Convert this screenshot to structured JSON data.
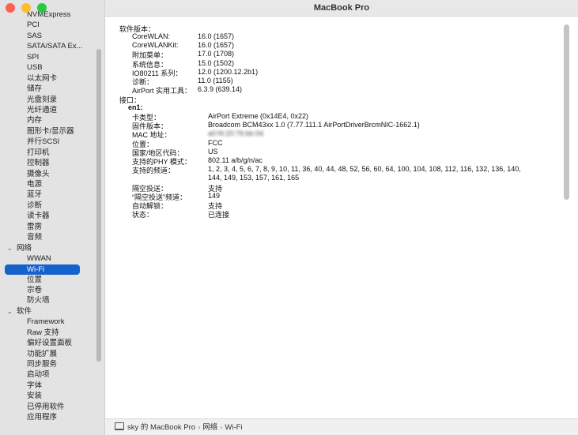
{
  "window": {
    "title": "MacBook Pro"
  },
  "colors": {
    "close": "#fe5f57",
    "minimize": "#febc2e",
    "maximize": "#28c840",
    "selection": "#1662cc"
  },
  "sidebar": {
    "items": [
      {
        "label": "NVMExpress",
        "kind": "item"
      },
      {
        "label": "PCI",
        "kind": "item"
      },
      {
        "label": "SAS",
        "kind": "item"
      },
      {
        "label": "SATA/SATA Ex...",
        "kind": "item"
      },
      {
        "label": "SPI",
        "kind": "item"
      },
      {
        "label": "USB",
        "kind": "item"
      },
      {
        "label": "以太网卡",
        "kind": "item"
      },
      {
        "label": "储存",
        "kind": "item"
      },
      {
        "label": "光盘刻录",
        "kind": "item"
      },
      {
        "label": "光纤通道",
        "kind": "item"
      },
      {
        "label": "内存",
        "kind": "item"
      },
      {
        "label": "图形卡/显示器",
        "kind": "item"
      },
      {
        "label": "并行SCSI",
        "kind": "item"
      },
      {
        "label": "打印机",
        "kind": "item"
      },
      {
        "label": "控制器",
        "kind": "item"
      },
      {
        "label": "摄像头",
        "kind": "item"
      },
      {
        "label": "电源",
        "kind": "item"
      },
      {
        "label": "蓝牙",
        "kind": "item"
      },
      {
        "label": "诊断",
        "kind": "item"
      },
      {
        "label": "读卡器",
        "kind": "item"
      },
      {
        "label": "雷雳",
        "kind": "item"
      },
      {
        "label": "音频",
        "kind": "item"
      },
      {
        "label": "网络",
        "kind": "group"
      },
      {
        "label": "WWAN",
        "kind": "item"
      },
      {
        "label": "Wi-Fi",
        "kind": "selected"
      },
      {
        "label": "位置",
        "kind": "item"
      },
      {
        "label": "宗卷",
        "kind": "item"
      },
      {
        "label": "防火墙",
        "kind": "item"
      },
      {
        "label": "软件",
        "kind": "group"
      },
      {
        "label": "Framework",
        "kind": "item"
      },
      {
        "label": "Raw 支持",
        "kind": "item"
      },
      {
        "label": "偏好设置面板",
        "kind": "item"
      },
      {
        "label": "功能扩展",
        "kind": "item"
      },
      {
        "label": "同步服务",
        "kind": "item"
      },
      {
        "label": "启动项",
        "kind": "item"
      },
      {
        "label": "字体",
        "kind": "item"
      },
      {
        "label": "安装",
        "kind": "item"
      },
      {
        "label": "已停用软件",
        "kind": "item"
      },
      {
        "label": "应用程序",
        "kind": "item"
      }
    ]
  },
  "content": {
    "software_header": "软件版本：",
    "software_rows": [
      {
        "key": "CoreWLAN:",
        "value": "16.0 (1657)"
      },
      {
        "key": "CoreWLANKit:",
        "value": "16.0 (1657)"
      },
      {
        "key": "附加菜单：",
        "value": "17.0 (1708)"
      },
      {
        "key": "系统信息：",
        "value": "15.0 (1502)"
      },
      {
        "key": "IO80211 系列：",
        "value": "12.0 (1200.12.2b1)"
      },
      {
        "key": "诊断：",
        "value": "11.0 (1155)"
      },
      {
        "key": "AirPort 实用工具：",
        "value": "6.3.9 (639.14)"
      }
    ],
    "interfaces_header": "接口：",
    "interface_name": "en1:",
    "interface_rows": [
      {
        "key": "卡类型：",
        "value": "AirPort Extreme  (0x14E4, 0x22)"
      },
      {
        "key": "固件版本：",
        "value": "Broadcom BCM43xx 1.0 (7.77.111.1 AirPortDriverBrcmNIC-1662.1)"
      },
      {
        "key": "MAC 地址：",
        "value": "a0:f4:20:76:bb:0d"
      },
      {
        "key": "位置：",
        "value": "FCC"
      },
      {
        "key": "国家/地区代码：",
        "value": "US"
      },
      {
        "key": "支持的PHY 模式：",
        "value": "802.11 a/b/g/n/ac"
      },
      {
        "key": "支持的频道：",
        "value": "1, 2, 3, 4, 5, 6, 7, 8, 9, 10, 11, 36, 40, 44, 48, 52, 56, 60, 64, 100, 104, 108, 112, 116, 132, 136, 140,"
      },
      {
        "key": "",
        "value": "144, 149, 153, 157, 161, 165"
      },
      {
        "key": "隔空投送：",
        "value": "支持"
      },
      {
        "key": "“隔空投送”频道：",
        "value": "149"
      },
      {
        "key": "自动解锁：",
        "value": "支持"
      },
      {
        "key": "状态：",
        "value": "已连接"
      }
    ]
  },
  "statusbar": {
    "icon": "laptop-icon",
    "path": [
      "sky 的 MacBook Pro",
      "网络",
      "Wi-Fi"
    ],
    "separator": "›"
  }
}
